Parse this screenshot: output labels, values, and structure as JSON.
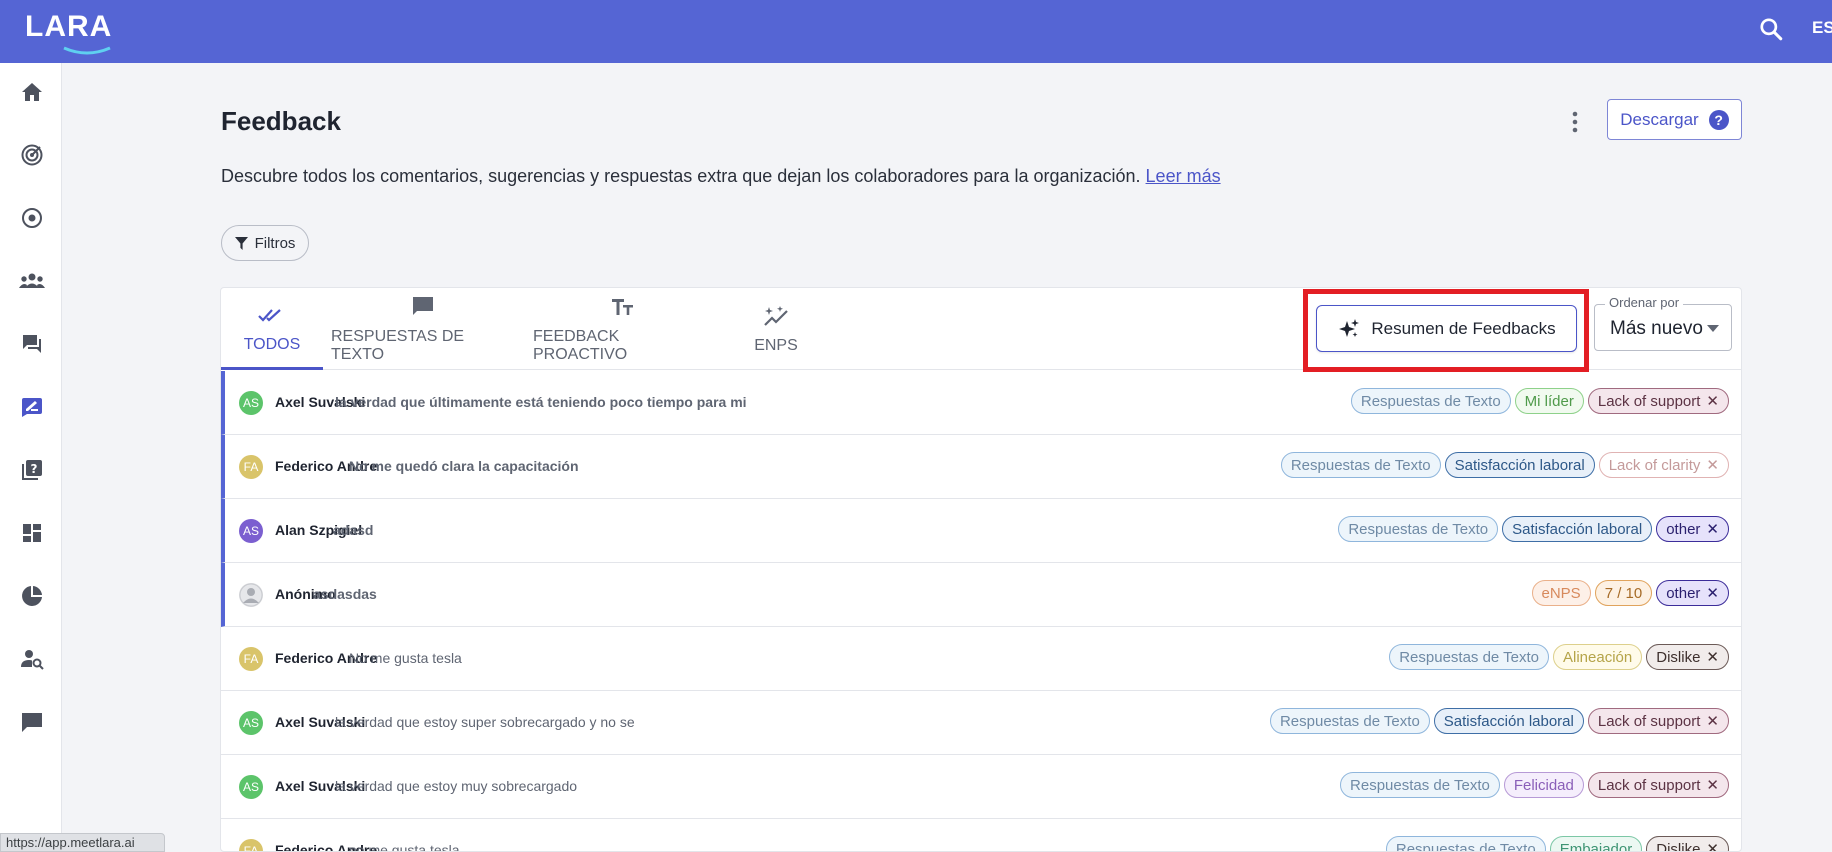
{
  "topbar": {
    "logo": "LARA",
    "lang": "ES"
  },
  "sidebar": {
    "items": [
      "home-icon",
      "radar-icon",
      "target-icon",
      "team-icon",
      "chat-icon",
      "feedback-icon",
      "question-book-icon",
      "dashboard-icon",
      "pie-chart-icon",
      "user-search-icon",
      "message-icon"
    ]
  },
  "header": {
    "title": "Feedback",
    "download_label": "Descargar",
    "help": "?",
    "description": "Descubre todos los comentarios, sugerencias y respuestas extra que dejan los colaboradores para la organización.",
    "read_more": "Leer más",
    "filters_label": "Filtros"
  },
  "tabs": [
    {
      "label": "TODOS",
      "icon": "double-check-icon",
      "active": true
    },
    {
      "label": "RESPUESTAS DE TEXTO",
      "icon": "comment-icon",
      "active": false
    },
    {
      "label": "FEEDBACK PROACTIVO",
      "icon": "text-size-icon",
      "active": false
    },
    {
      "label": "ENPS",
      "icon": "sparkle-trend-icon",
      "active": false
    }
  ],
  "summary_button": {
    "label": "Resumen de Feedbacks",
    "icon": "sparkles-icon"
  },
  "sort": {
    "label": "Ordenar por",
    "value": "Más nuevo"
  },
  "colors": {
    "accent": "#5565d4",
    "highlight": "#e31e24"
  },
  "rows": [
    {
      "initials": "AS",
      "avatar_color": "#5cc46a",
      "name": "Axel Suvalski",
      "comment": "la verdad que últimamente está teniendo poco tiempo para mi",
      "unread": true,
      "tags": [
        {
          "text": "Respuestas de Texto",
          "tone": "blue"
        },
        {
          "text": "Mi líder",
          "tone": "green"
        },
        {
          "text": "Lack of support",
          "tone": "maroon",
          "closable": true
        }
      ]
    },
    {
      "initials": "FA",
      "avatar_color": "#d9c46a",
      "name": "Federico Andre",
      "comment": "No me quedó clara la capacitación",
      "unread": true,
      "tags": [
        {
          "text": "Respuestas de Texto",
          "tone": "blue"
        },
        {
          "text": "Satisfacción laboral",
          "tone": "navy"
        },
        {
          "text": "Lack of clarity",
          "tone": "rose",
          "closable": true
        }
      ]
    },
    {
      "initials": "AS",
      "avatar_color": "#7b5fd0",
      "name": "Alan Szpigiel",
      "comment": "adasd",
      "unread": true,
      "tags": [
        {
          "text": "Respuestas de Texto",
          "tone": "blue"
        },
        {
          "text": "Satisfacción laboral",
          "tone": "navy"
        },
        {
          "text": "other",
          "tone": "indigo",
          "closable": true
        }
      ]
    },
    {
      "initials": "",
      "avatar_color": "#d8d9dc",
      "name": "Anónimo",
      "comment": "asdasdas",
      "unread": true,
      "tags": [
        {
          "text": "eNPS",
          "tone": "orange"
        },
        {
          "text": "7 / 10",
          "tone": "amber"
        },
        {
          "text": "other",
          "tone": "indigo",
          "closable": true
        }
      ]
    },
    {
      "initials": "FA",
      "avatar_color": "#d9c46a",
      "name": "Federico Andre",
      "comment": "No me gusta tesla",
      "unread": false,
      "tags": [
        {
          "text": "Respuestas de Texto",
          "tone": "blue"
        },
        {
          "text": "Alineación",
          "tone": "yellow"
        },
        {
          "text": "Dislike",
          "tone": "brown",
          "closable": true
        }
      ]
    },
    {
      "initials": "AS",
      "avatar_color": "#5cc46a",
      "name": "Axel Suvalski",
      "comment": "la verdad que estoy super sobrecargado y no se",
      "unread": false,
      "tags": [
        {
          "text": "Respuestas de Texto",
          "tone": "blue"
        },
        {
          "text": "Satisfacción laboral",
          "tone": "navy"
        },
        {
          "text": "Lack of support",
          "tone": "maroon",
          "closable": true
        }
      ]
    },
    {
      "initials": "AS",
      "avatar_color": "#5cc46a",
      "name": "Axel Suvalski",
      "comment": "la verdad que estoy muy sobrecargado",
      "unread": false,
      "tags": [
        {
          "text": "Respuestas de Texto",
          "tone": "blue"
        },
        {
          "text": "Felicidad",
          "tone": "purple"
        },
        {
          "text": "Lack of support",
          "tone": "maroon",
          "closable": true
        }
      ]
    },
    {
      "initials": "FA",
      "avatar_color": "#d9c46a",
      "name": "Federico Andre",
      "comment": "no me gusta tesla",
      "unread": false,
      "tags": [
        {
          "text": "Respuestas de Texto",
          "tone": "blue"
        },
        {
          "text": "Embajador",
          "tone": "teal"
        },
        {
          "text": "Dislike",
          "tone": "brown",
          "closable": true
        }
      ]
    }
  ],
  "status_bar": {
    "url": "https://app.meetlara.ai"
  }
}
